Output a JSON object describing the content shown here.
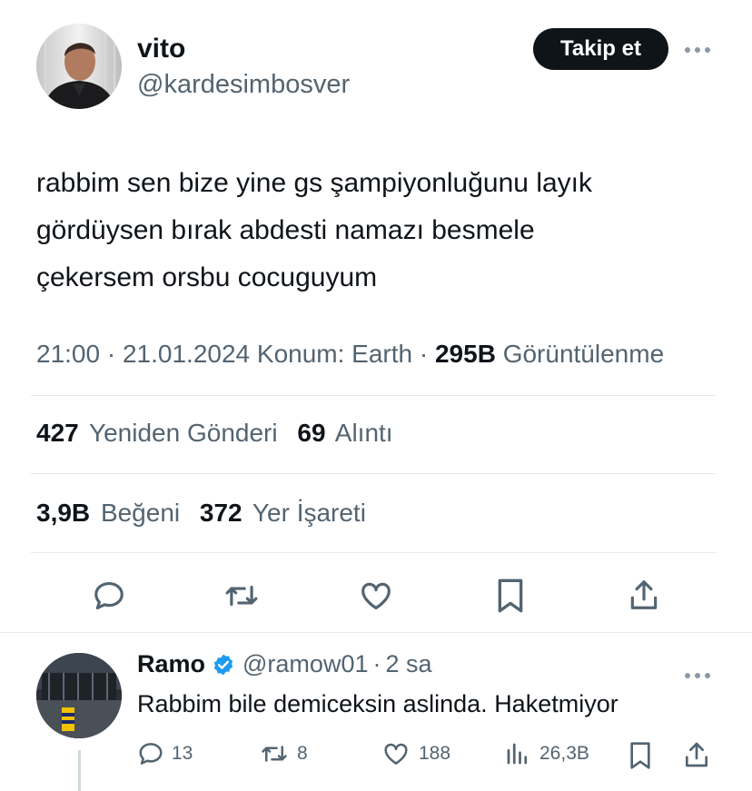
{
  "tweet": {
    "author": {
      "display_name": "vito",
      "handle": "@kardesimbosver",
      "avatar": "profile-photo-man-in-suit"
    },
    "follow_label": "Takip et",
    "more_icon": "more-horizontal-icon",
    "text_lines": [
      "rabbim sen bize yine gs şampiyonluğunu layık",
      "gördüysen bırak abdesti namazı besmele",
      "çekersem orsbu cocuguyum"
    ],
    "meta": {
      "time": "21:00",
      "sep1": "·",
      "date": "21.01.2024",
      "location": "Konum: Earth",
      "sep2": "·",
      "views_value": "295B",
      "views_label": "Görüntülenme"
    },
    "stats": {
      "retweets_value": "427",
      "retweets_label": "Yeniden Gönderi",
      "quotes_value": "69",
      "quotes_label": "Alıntı",
      "likes_value": "3,9B",
      "likes_label": "Beğeni",
      "bookmarks_value": "372",
      "bookmarks_label": "Yer İşareti"
    },
    "actions": [
      "reply-icon",
      "retweet-icon",
      "like-icon",
      "bookmark-icon",
      "share-icon"
    ]
  },
  "reply": {
    "display_name": "Ramo",
    "verified_icon": "verified-badge-icon",
    "handle": "@ramow01",
    "sep": "·",
    "time_ago": "2 sa",
    "text": "Rabbim bile demiceksin aslinda. Haketmiyor",
    "avatar": "profile-photo-stadium",
    "actions": {
      "replies": "13",
      "retweets": "8",
      "likes": "188",
      "views": "26,3B"
    }
  },
  "colors": {
    "text": "#0f1419",
    "muted": "#536471",
    "verified": "#1d9bf0",
    "divider": "#e6e9ec",
    "button": "#0f1419"
  }
}
